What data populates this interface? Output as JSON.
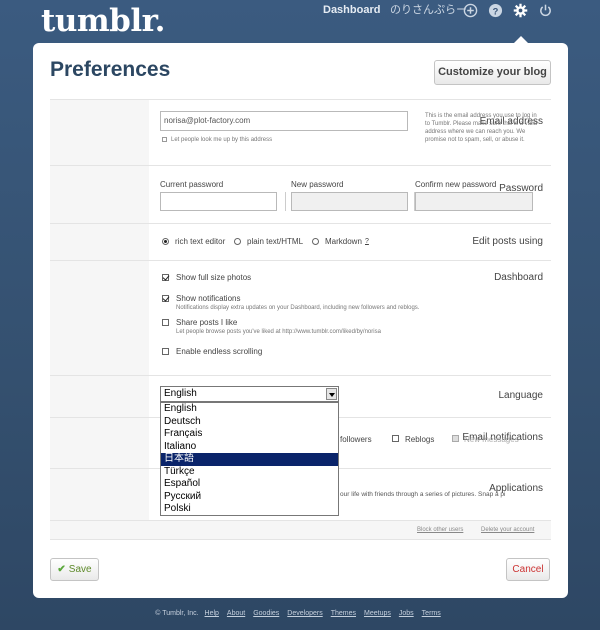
{
  "brand": {
    "logo": "tumblr."
  },
  "nav": {
    "dashboard": "Dashboard",
    "user": "のりさんぷらー"
  },
  "page": {
    "title": "Preferences",
    "customize_label": "Customize your blog"
  },
  "email": {
    "label": "Email address",
    "value": "norisa@plot-factory.com",
    "lookup_label": "Let people look me up by this address",
    "side_note": "This is the email address you use to log in to Tumblr. Please make sure this is a valid address where we can reach you. We promise not to spam, sell, or abuse it."
  },
  "password": {
    "label": "Password",
    "current_label": "Current password",
    "new_label": "New password",
    "confirm_label": "Confirm new password"
  },
  "edit_posts": {
    "label": "Edit posts using",
    "options": [
      "rich text editor",
      "plain text/HTML",
      "Markdown"
    ],
    "help": "?"
  },
  "dashboard": {
    "label": "Dashboard",
    "show_full_size": "Show full size photos",
    "show_notifications": "Show notifications",
    "notifications_hint": "Notifications display extra updates on your Dashboard, including new followers and reblogs.",
    "share_posts": "Share posts I like",
    "share_hint": "Let people browse posts you've liked at http://www.tumblr.com/liked/by/norisa",
    "endless_scrolling": "Enable endless scrolling"
  },
  "language": {
    "label": "Language",
    "selected": "English",
    "options": [
      "English",
      "Deutsch",
      "Français",
      "Italiano",
      "日本語",
      "Türkçe",
      "Español",
      "Русский",
      "Polski"
    ],
    "highlighted_index": 4
  },
  "email_notifications": {
    "label": "Email notifications",
    "followers": "followers",
    "reblogs": "Reblogs",
    "new_messages": "New messages"
  },
  "applications": {
    "label": "Applications",
    "text": "our life with friends through a series of pictures. Snap a pi"
  },
  "account_links": {
    "block": "Block other users",
    "delete": "Delete your account"
  },
  "actions": {
    "save": "Save",
    "cancel": "Cancel"
  },
  "footer": {
    "copyright": "© Tumblr, Inc.",
    "links": [
      "Help",
      "About",
      "Goodies",
      "Developers",
      "Themes",
      "Meetups",
      "Jobs",
      "Terms"
    ]
  }
}
